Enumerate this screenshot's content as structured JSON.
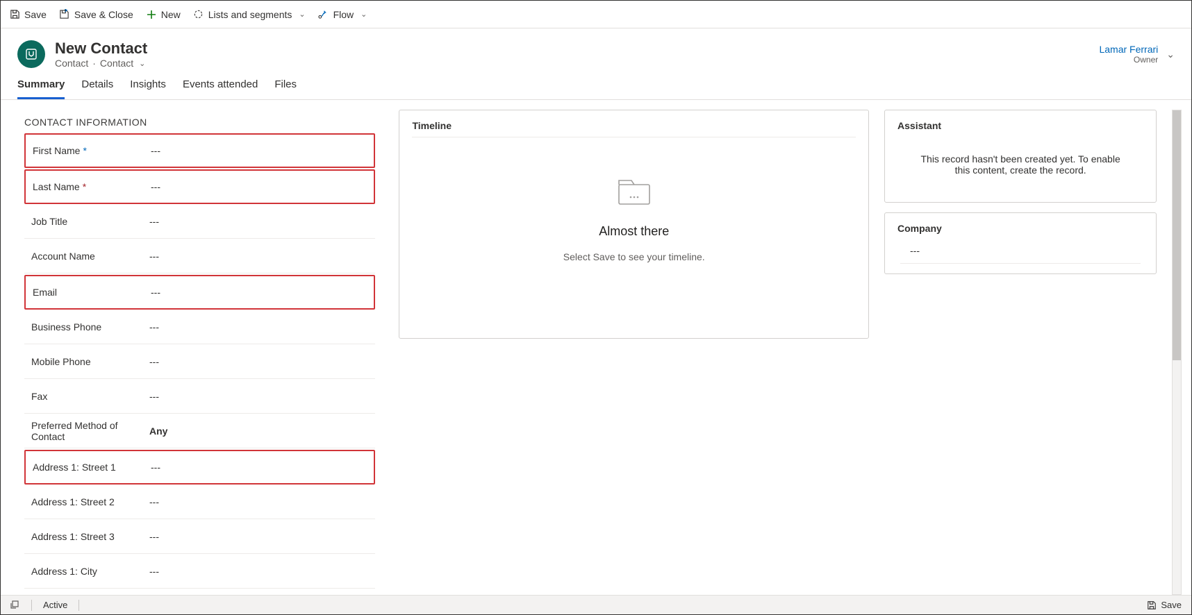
{
  "toolbar": {
    "save": "Save",
    "save_close": "Save & Close",
    "new": "New",
    "lists": "Lists and segments",
    "flow": "Flow"
  },
  "header": {
    "title": "New Contact",
    "entity": "Contact",
    "form": "Contact",
    "owner_name": "Lamar Ferrari",
    "owner_label": "Owner"
  },
  "tabs": [
    "Summary",
    "Details",
    "Insights",
    "Events attended",
    "Files"
  ],
  "active_tab": 0,
  "contact_section": {
    "heading": "CONTACT INFORMATION",
    "fields": [
      {
        "label": "First Name",
        "value": "---",
        "marker": "rec",
        "highlight": true
      },
      {
        "label": "Last Name",
        "value": "---",
        "marker": "req",
        "highlight": true
      },
      {
        "label": "Job Title",
        "value": "---"
      },
      {
        "label": "Account Name",
        "value": "---"
      },
      {
        "label": "Email",
        "value": "---",
        "highlight": true
      },
      {
        "label": "Business Phone",
        "value": "---"
      },
      {
        "label": "Mobile Phone",
        "value": "---"
      },
      {
        "label": "Fax",
        "value": "---"
      },
      {
        "label": "Preferred Method of Contact",
        "value": "Any",
        "bold": true
      },
      {
        "label": "Address 1: Street 1",
        "value": "---",
        "highlight": true
      },
      {
        "label": "Address 1: Street 2",
        "value": "---"
      },
      {
        "label": "Address 1: Street 3",
        "value": "---"
      },
      {
        "label": "Address 1: City",
        "value": "---"
      }
    ]
  },
  "timeline": {
    "title": "Timeline",
    "heading": "Almost there",
    "message": "Select Save to see your timeline."
  },
  "assistant": {
    "title": "Assistant",
    "message": "This record hasn't been created yet. To enable this content, create the record."
  },
  "company": {
    "title": "Company",
    "value": "---"
  },
  "footer": {
    "status": "Active",
    "save": "Save"
  }
}
